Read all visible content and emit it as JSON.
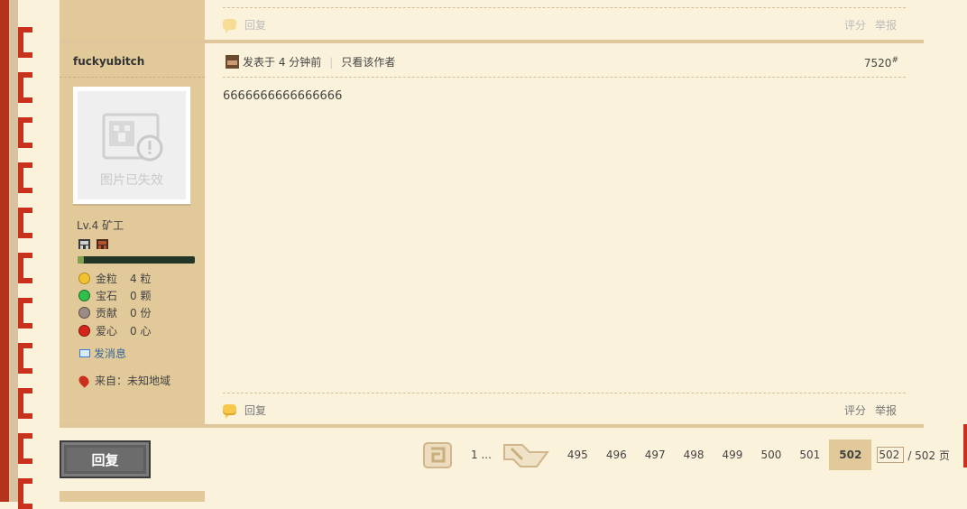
{
  "top_post": {
    "reply_label": "回复",
    "rate_label": "评分",
    "report_label": "举报"
  },
  "post": {
    "author": "fuckyubitch",
    "avatar_placeholder": "图片已失效",
    "level": "Lv.4 矿工",
    "exp_progress": 0.05,
    "stats": [
      {
        "icon": "gold-nugget-icon",
        "label": "金粒",
        "value": "4 粒"
      },
      {
        "icon": "emerald-icon",
        "label": "宝石",
        "value": "0 颗"
      },
      {
        "icon": "contribution-icon",
        "label": "贡献",
        "value": "0 份"
      },
      {
        "icon": "apple-heart-icon",
        "label": "爱心",
        "value": "0 心"
      }
    ],
    "send_message": "发消息",
    "from_label": "来自：未知地域",
    "posted_time": "发表于 4 分钟前",
    "only_author": "只看该作者",
    "floor_number": "7520",
    "floor_mark": "#",
    "content": "6666666666666666",
    "reply_label": "回复",
    "rate_label": "评分",
    "report_label": "举报"
  },
  "bottom": {
    "reply_button": "回复",
    "pagination": {
      "first": "1 ...",
      "pages": [
        "495",
        "496",
        "497",
        "498",
        "499",
        "500",
        "501"
      ],
      "current": "502",
      "input_value": "502",
      "total": "/ 502 页"
    }
  },
  "colors": {
    "background": "#fbf2db",
    "sidebar": "#e2c99a",
    "accent_red": "#c9311c"
  }
}
